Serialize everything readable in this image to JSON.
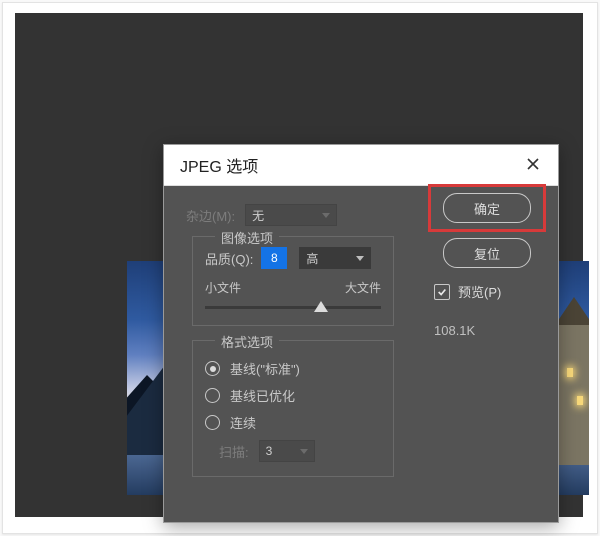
{
  "dialog": {
    "title": "JPEG 选项",
    "matte_label": "杂边(M):",
    "matte_value": "无",
    "image_options_legend": "图像选项",
    "quality_label": "品质(Q):",
    "quality_value": "8",
    "quality_preset": "高",
    "slider_min_label": "小文件",
    "slider_max_label": "大文件",
    "slider_position_pct": 66,
    "format_options_legend": "格式选项",
    "format_options": [
      {
        "label": "基线(\"标准\")",
        "checked": true
      },
      {
        "label": "基线已优化",
        "checked": false
      },
      {
        "label": "连续",
        "checked": false
      }
    ],
    "scans_label": "扫描:",
    "scans_value": "3",
    "ok_label": "确定",
    "reset_label": "复位",
    "preview_label": "预览(P)",
    "preview_checked": true,
    "file_size": "108.1K"
  }
}
